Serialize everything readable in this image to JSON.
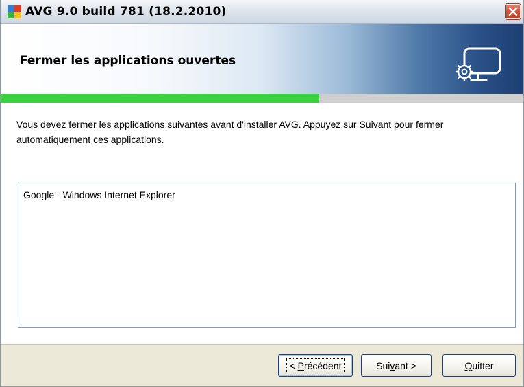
{
  "window": {
    "title": "AVG 9.0 build 781 (18.2.2010)"
  },
  "header": {
    "title": "Fermer les applications ouvertes",
    "icon": "computer-gear-icon"
  },
  "progress": {
    "fraction": 0.61,
    "color": "#3bd141"
  },
  "content": {
    "instructions": "Vous devez fermer les applications suivantes avant d'installer AVG. Appuyez sur Suivant pour fermer automatiquement ces applications.",
    "applications": [
      "Google - Windows Internet Explorer"
    ]
  },
  "buttons": {
    "previous": {
      "before": "< ",
      "mnemonic": "P",
      "after": "récédent"
    },
    "next": {
      "before": "Sui",
      "mnemonic": "v",
      "after": "ant >"
    },
    "quit": {
      "before": "",
      "mnemonic": "Q",
      "after": "uitter"
    }
  },
  "colors": {
    "banner_dark": "#1d3f73",
    "close_button": "#d35136"
  }
}
